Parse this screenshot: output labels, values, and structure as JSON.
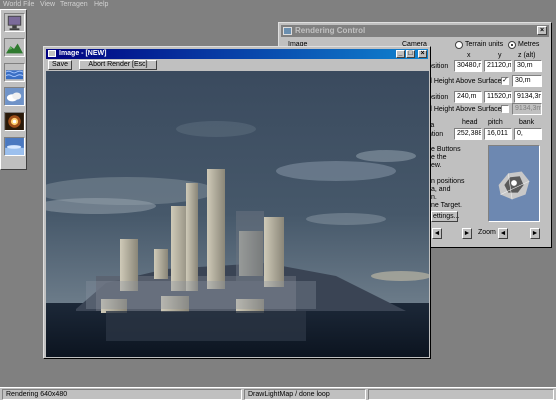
{
  "menu": [
    "World File",
    "View",
    "Terragen",
    "Help"
  ],
  "palette": {
    "tools": [
      {
        "name": "rendering-control-icon"
      },
      {
        "name": "landscape-icon"
      },
      {
        "name": "water-icon"
      },
      {
        "name": "clouds-icon"
      },
      {
        "name": "sun-icon"
      },
      {
        "name": "atmosphere-icon"
      }
    ]
  },
  "rendering_control": {
    "title": "Rendering Control",
    "close": "×",
    "image_label": "Image",
    "camera_label": "Camera",
    "units": {
      "terrain_label": "Terrain units",
      "metres_label": "Metres",
      "selected": "Metres"
    },
    "columns": {
      "x": "x",
      "y": "y",
      "z": "z (alt)"
    },
    "camera_position": {
      "label": "osition",
      "x": "30480,m",
      "y": "21120,m",
      "z": "30,m"
    },
    "camera_height": {
      "label": "d Height Above Surface",
      "checked": true,
      "value": "30,m"
    },
    "target_position": {
      "label": "osition",
      "x": "240,m",
      "y": "11520,m",
      "z": "9134,3m"
    },
    "target_height": {
      "label": "d Height Above Surface",
      "checked": false,
      "value": "9134,3m"
    },
    "orientation": {
      "label_top": "ra",
      "label_bottom": "ntion",
      "head_label": "head",
      "pitch_label": "pitch",
      "bank_label": "bank",
      "head": "252,388",
      "pitch": "16,011",
      "bank": "0,"
    },
    "help_lines": [
      "e Buttons",
      "e the",
      "ew.",
      "",
      "n positions",
      "a, and",
      "n.",
      "ne Target."
    ],
    "settings_button": "ettings...",
    "zoom_label": "Zoom",
    "left_arrow": "◄",
    "right_arrow": "►"
  },
  "image_window": {
    "title": "Image - [NEW]",
    "save_button": "Save",
    "abort_button": "Abort Render [Esc]",
    "minimize": "_",
    "maximize": "□",
    "close": "×"
  },
  "status": {
    "left": "Rendering 640x480",
    "middle": "DrawLightMap / done loop",
    "right": ""
  }
}
